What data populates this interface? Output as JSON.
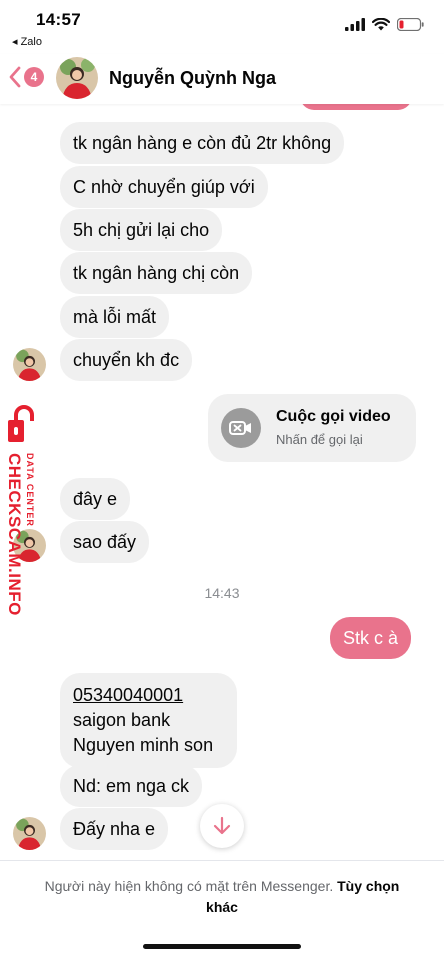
{
  "status_bar": {
    "time": "14:57",
    "back_app": "◂ Zalo",
    "battery_color": "#e5202f"
  },
  "header": {
    "unread_count": "4",
    "contact_name": "Nguyễn Quỳnh Nga"
  },
  "messages": {
    "m1": "tk ngân hàng e còn đủ 2tr không",
    "m2": "C nhờ chuyển giúp với",
    "m3": "5h chị gửi lại cho",
    "m4": "tk ngân hàng chị còn",
    "m5": "mà lỗi mất",
    "m6": "chuyển kh đc",
    "m7": "đây e",
    "m8": "sao đấy",
    "m9": "Stk c à",
    "m10_lines": [
      "05340040001",
      "saigon bank",
      "Nguyen minh son"
    ],
    "m11": "Nd: em nga ck",
    "m12": "Đấy nha e"
  },
  "call": {
    "title": "Cuộc gọi video",
    "subtitle": "Nhấn để gọi lại"
  },
  "timestamp": "14:43",
  "watermark": {
    "main": "CHECKSCAM.INFO",
    "sub": "DATA CENTER"
  },
  "footer": {
    "note": "Người này hiện không có mặt trên Messenger.",
    "action": "Tùy chọn khác"
  },
  "colors": {
    "accent": "#e9738c",
    "incoming_bubble": "#f0f0f0",
    "watermark": "#e5202f"
  }
}
